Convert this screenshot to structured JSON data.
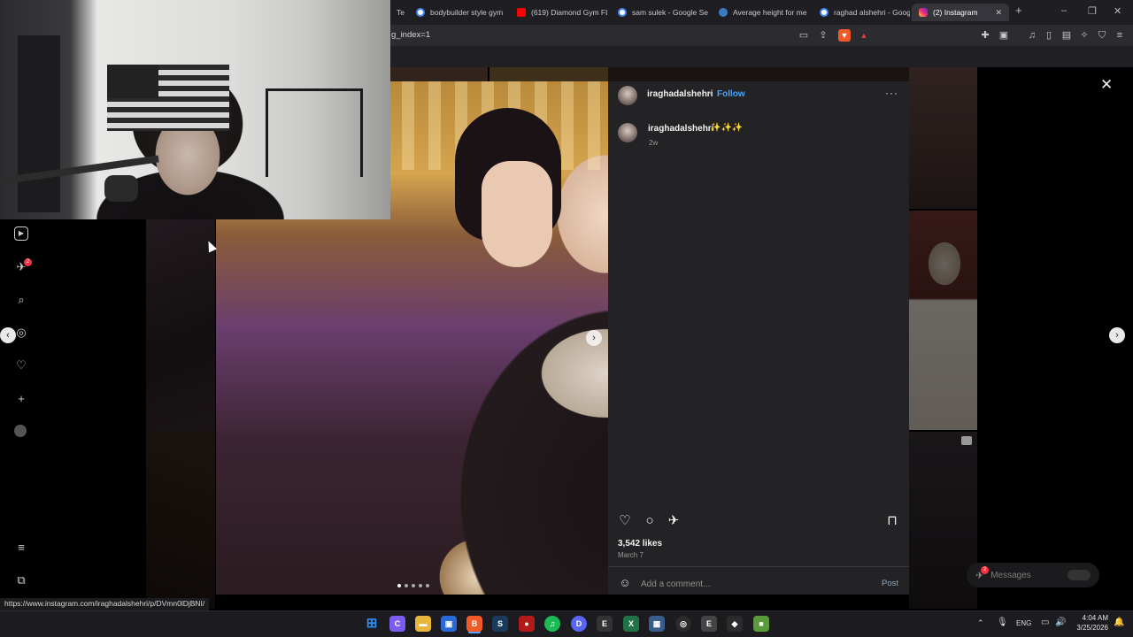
{
  "browser": {
    "tabs": [
      {
        "label": "Te",
        "favicon_color": "#e94b3c"
      },
      {
        "label": "bodybuilder style gym",
        "favicon_color": "#4285f4"
      },
      {
        "label": "(619) Diamond Gym FL",
        "favicon_color": "#ff0000"
      },
      {
        "label": "sam sulek - Google Se",
        "favicon_color": "#4285f4"
      },
      {
        "label": "Average height for me",
        "favicon_color": "#3b7bbf"
      },
      {
        "label": "raghad alshehri - Goog",
        "favicon_color": "#4285f4"
      },
      {
        "label": "(2) Instagram",
        "favicon_color": "#e1306c",
        "active": true
      }
    ],
    "new_tab_label": "+",
    "window_controls": {
      "minimize": "–",
      "restore": "❐",
      "close": "✕"
    },
    "url_fragment": "g_index=1",
    "status_link": "https://www.instagram.com/iraghadalshehri/p/DVmn0lDjBNI/"
  },
  "instagram_nav": {
    "icons": [
      "reels-icon",
      "messages-icon",
      "search-icon",
      "explore-icon",
      "heart-icon",
      "create-icon",
      "profile-icon",
      "menu-icon",
      "more-apps-icon"
    ],
    "messages_badge": "2"
  },
  "post": {
    "username": "iraghadalshehri",
    "separator": "•",
    "follow_label": "Follow",
    "more_label": "···",
    "caption_user": "iraghadalshehri",
    "caption_text": "✨✨✨",
    "caption_time": "2w",
    "likes": "3,542 likes",
    "date": "March 7",
    "comment_placeholder": "Add a comment...",
    "post_label": "Post",
    "close_label": "✕",
    "image_next_label": "›",
    "modal_prev_label": "‹",
    "modal_next_label": "›",
    "carousel_dots": 5,
    "carousel_active": 0
  },
  "messages_pill": {
    "label": "Messages",
    "badge": "2"
  },
  "taskbar": {
    "apps": [
      {
        "name": "windows-start",
        "color": "#2f8cf0",
        "glyph": "⊞"
      },
      {
        "name": "copilot",
        "color": "#7b5cf0",
        "glyph": "C"
      },
      {
        "name": "file-explorer",
        "color": "#e8b63a",
        "glyph": "▬"
      },
      {
        "name": "store",
        "color": "#2a6ad6",
        "glyph": "▣"
      },
      {
        "name": "brave",
        "color": "#f05a28",
        "glyph": "B"
      },
      {
        "name": "steam",
        "color": "#1b3a5c",
        "glyph": "S"
      },
      {
        "name": "record",
        "color": "#b31b1b",
        "glyph": "●"
      },
      {
        "name": "spotify",
        "color": "#1db954",
        "glyph": "♫"
      },
      {
        "name": "discord",
        "color": "#5865f2",
        "glyph": "D"
      },
      {
        "name": "epic-games",
        "color": "#333333",
        "glyph": "E"
      },
      {
        "name": "excel",
        "color": "#217346",
        "glyph": "X"
      },
      {
        "name": "calculator",
        "color": "#3a5c8a",
        "glyph": "▦"
      },
      {
        "name": "obs",
        "color": "#2b2b2b",
        "glyph": "◎"
      },
      {
        "name": "epic-2",
        "color": "#444444",
        "glyph": "E"
      },
      {
        "name": "notifications-app",
        "color": "#2b2b2b",
        "glyph": "◆"
      },
      {
        "name": "minecraft",
        "color": "#5a9a3a",
        "glyph": "■"
      }
    ],
    "tray": {
      "language": "ENG",
      "time": "4:04 AM",
      "date": "3/25/2026"
    }
  }
}
